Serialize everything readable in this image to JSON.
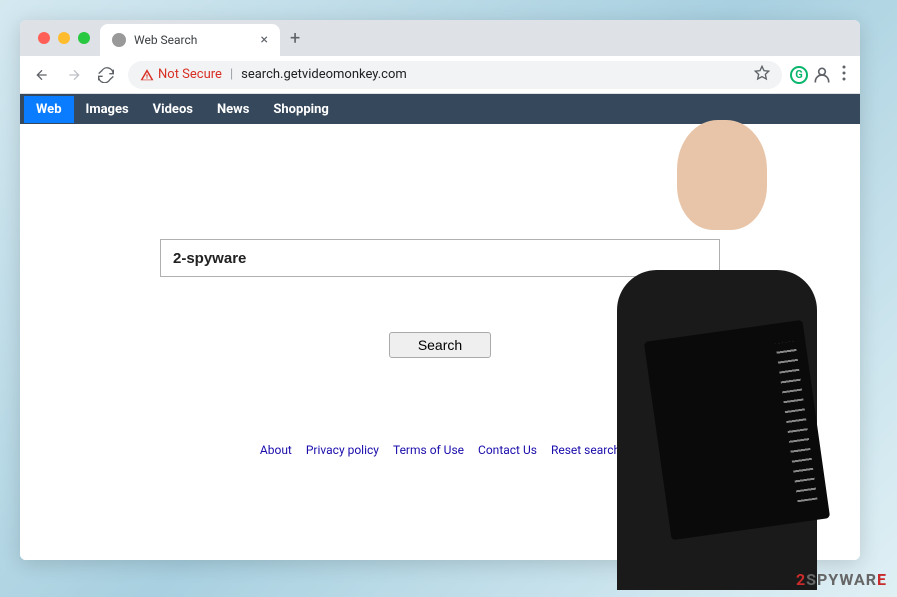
{
  "browser": {
    "tab_title": "Web Search",
    "not_secure_label": "Not Secure",
    "url": "search.getvideomonkey.com"
  },
  "search_nav": {
    "items": [
      {
        "label": "Web",
        "active": true
      },
      {
        "label": "Images",
        "active": false
      },
      {
        "label": "Videos",
        "active": false
      },
      {
        "label": "News",
        "active": false
      },
      {
        "label": "Shopping",
        "active": false
      }
    ]
  },
  "search": {
    "input_value": "2-spyware",
    "button_label": "Search"
  },
  "footer": {
    "links": [
      "About",
      "Privacy policy",
      "Terms of Use",
      "Contact Us",
      "Reset search"
    ]
  },
  "watermark": {
    "prefix_digit": "2",
    "text": "SPYWAR",
    "suffix": "E"
  }
}
